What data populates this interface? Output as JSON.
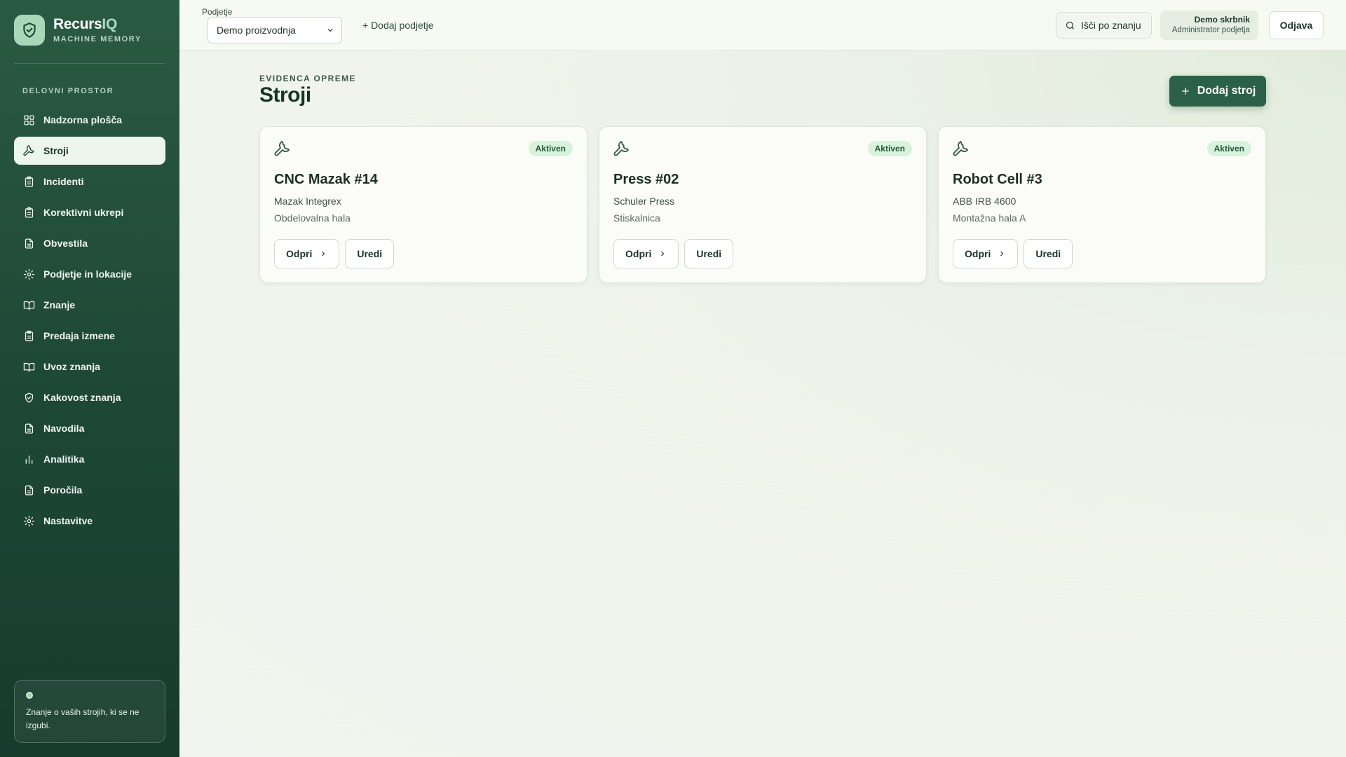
{
  "brand": {
    "name_main": "Recurs",
    "name_accent": "IQ",
    "tagline": "MACHINE MEMORY"
  },
  "sidebar": {
    "heading": "DELOVNI PROSTOR",
    "items": [
      {
        "label": "Nadzorna plošča",
        "icon": "dashboard-icon",
        "active": false
      },
      {
        "label": "Stroji",
        "icon": "wrench-icon",
        "active": true
      },
      {
        "label": "Incidenti",
        "icon": "clipboard-icon",
        "active": false
      },
      {
        "label": "Korektivni ukrepi",
        "icon": "clipboard-icon",
        "active": false
      },
      {
        "label": "Obvestila",
        "icon": "document-icon",
        "active": false
      },
      {
        "label": "Podjetje in lokacije",
        "icon": "gear-icon",
        "active": false
      },
      {
        "label": "Znanje",
        "icon": "book-icon",
        "active": false
      },
      {
        "label": "Predaja izmene",
        "icon": "clipboard-icon",
        "active": false
      },
      {
        "label": "Uvoz znanja",
        "icon": "book-icon",
        "active": false
      },
      {
        "label": "Kakovost znanja",
        "icon": "shield-icon",
        "active": false
      },
      {
        "label": "Navodila",
        "icon": "document-icon",
        "active": false
      },
      {
        "label": "Analitika",
        "icon": "bar-chart-icon",
        "active": false
      },
      {
        "label": "Poročila",
        "icon": "document-icon",
        "active": false
      },
      {
        "label": "Nastavitve",
        "icon": "gear-icon",
        "active": false
      }
    ],
    "note": "Znanje o vaših strojih, ki se ne izgubi."
  },
  "topbar": {
    "company_label": "Podjetje",
    "company_value": "Demo proizvodnja",
    "add_company": "+ Dodaj podjetje",
    "search": "Išči po znanju",
    "user_name": "Demo skrbnik",
    "user_role": "Administrator podjetja",
    "logout": "Odjava"
  },
  "main": {
    "eyebrow": "EVIDENCA OPREME",
    "title": "Stroji",
    "add_button": "Dodaj stroj",
    "open_label": "Odpri",
    "edit_label": "Uredi",
    "machines": [
      {
        "name": "CNC Mazak #14",
        "model": "Mazak Integrex",
        "location": "Obdelovalna hala",
        "status": "Aktiven"
      },
      {
        "name": "Press #02",
        "model": "Schuler Press",
        "location": "Stiskalnica",
        "status": "Aktiven"
      },
      {
        "name": "Robot Cell #3",
        "model": "ABB IRB 4600",
        "location": "Montažna hala A",
        "status": "Aktiven"
      }
    ]
  },
  "colors": {
    "sidebar_bg": "#1f4a37",
    "primary": "#2b6149",
    "badge_bg": "#d9f2dd",
    "badge_text": "#1f5c39",
    "page_bg": "#f1f5ee"
  }
}
